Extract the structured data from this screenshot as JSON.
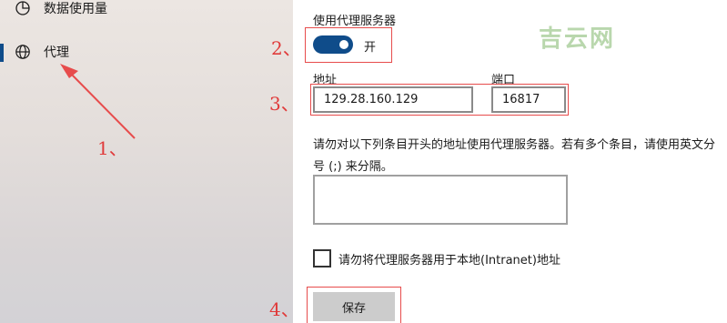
{
  "sidebar": {
    "items": [
      {
        "label": "数据使用量",
        "icon": "pie-chart-icon"
      },
      {
        "label": "代理",
        "icon": "globe-icon",
        "active": true
      }
    ]
  },
  "proxy": {
    "title": "使用代理服务器",
    "toggle_state": "开",
    "toggle_on": true,
    "address_label": "地址",
    "address_value": "129.28.160.129",
    "port_label": "端口",
    "port_value": "16817",
    "exceptions_desc": "请勿对以下列条目开头的地址使用代理服务器。若有多个条目，请使用英文分号 (;) 来分隔。",
    "exceptions_value": "",
    "local_checkbox_label": "请勿将代理服务器用于本地(Intranet)地址",
    "local_checkbox_checked": false,
    "save_label": "保存"
  },
  "annotations": {
    "marker1": "1、",
    "marker2": "2、",
    "marker3": "3、",
    "marker4": "4、",
    "watermark": "吉云网"
  },
  "colors": {
    "accent": "#0f4c8a",
    "annotation_red": "#e74c4c",
    "watermark": "#b9d7ad"
  }
}
